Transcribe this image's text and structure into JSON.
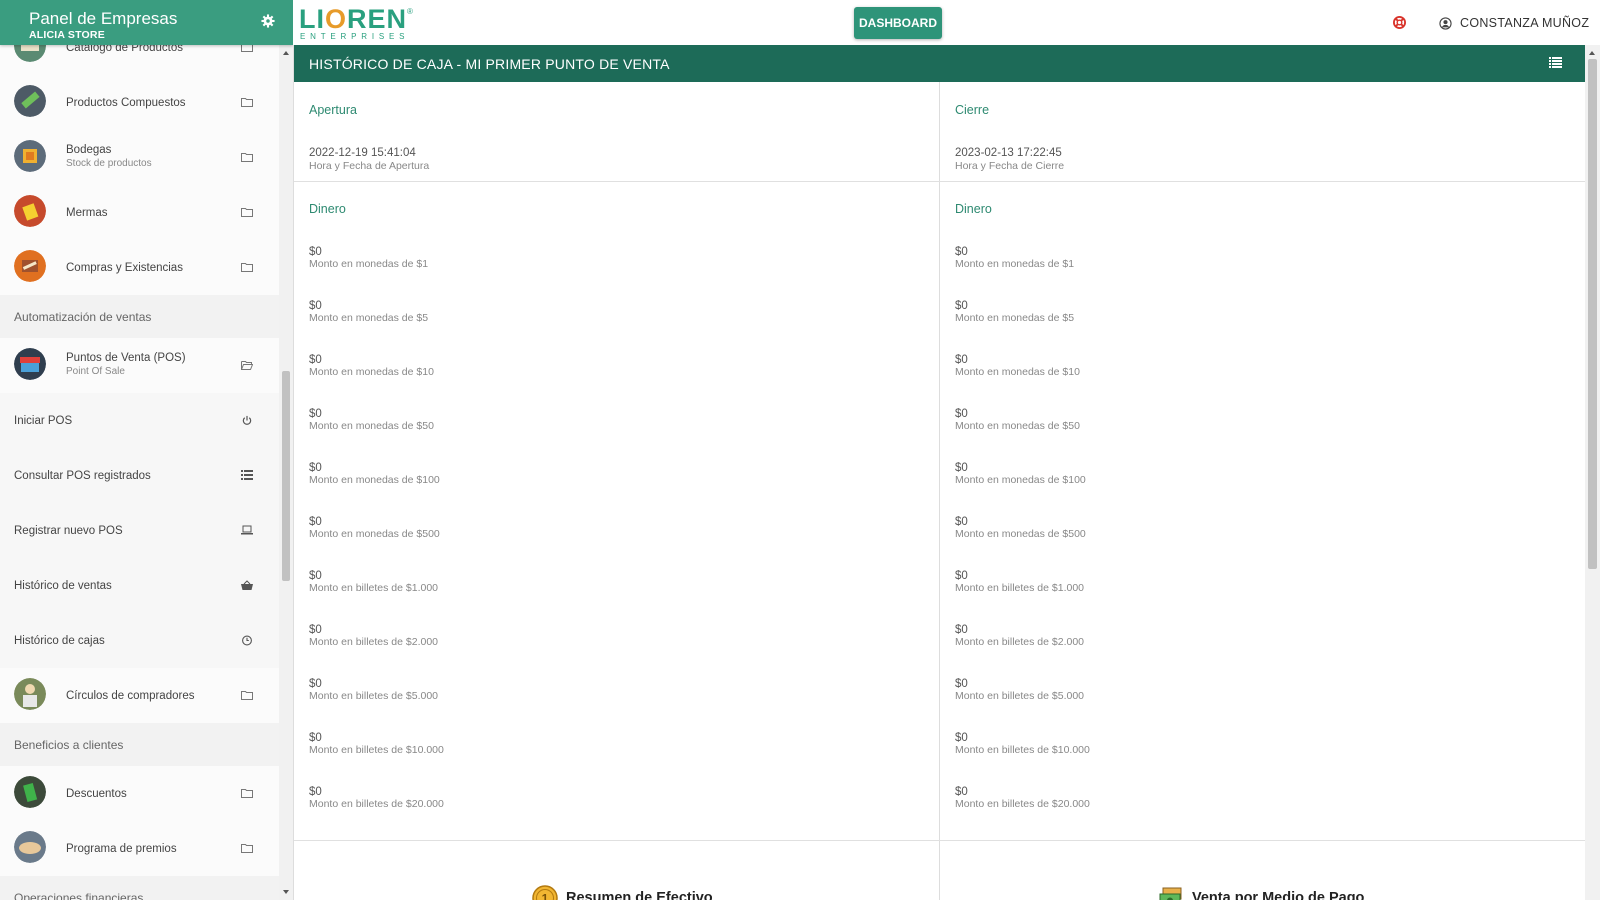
{
  "sidebar": {
    "title": "Panel de Empresas",
    "subtitle": "ALICIA STORE",
    "items": [
      {
        "label": "Catálogo de Productos"
      },
      {
        "label": "Productos Compuestos"
      },
      {
        "label": "Bodegas",
        "sub": "Stock de productos"
      },
      {
        "label": "Mermas"
      },
      {
        "label": "Compras y Existencias"
      }
    ],
    "section_automation": "Automatización de ventas",
    "pos": {
      "label": "Puntos de Venta (POS)",
      "sub": "Point Of Sale"
    },
    "pos_items": [
      {
        "label": "Iniciar POS"
      },
      {
        "label": "Consultar POS registrados"
      },
      {
        "label": "Registrar nuevo POS"
      },
      {
        "label": "Histórico de ventas"
      },
      {
        "label": "Histórico de cajas"
      }
    ],
    "circles": {
      "label": "Círculos de compradores"
    },
    "section_benefits": "Beneficios a clientes",
    "benefits": [
      {
        "label": "Descuentos"
      },
      {
        "label": "Programa de premios"
      }
    ],
    "section_financial": "Operaciones financieras"
  },
  "topbar": {
    "logo_word": "LIOREN",
    "logo_sub": "ENTERPRISES",
    "dashboard_label": "DASHBOARD",
    "user_name": "CONSTANZA MUÑOZ"
  },
  "main": {
    "title": "HISTÓRICO DE CAJA - MI PRIMER PUNTO DE VENTA",
    "opening": {
      "title": "Apertura",
      "datetime": "2022-12-19 15:41:04",
      "datetime_label": "Hora y Fecha de Apertura",
      "money_title": "Dinero"
    },
    "closing": {
      "title": "Cierre",
      "datetime": "2023-02-13 17:22:45",
      "datetime_label": "Hora y Fecha de Cierre",
      "money_title": "Dinero"
    },
    "amounts": [
      {
        "value": "$0",
        "label": "Monto en monedas de $1"
      },
      {
        "value": "$0",
        "label": "Monto en monedas de $5"
      },
      {
        "value": "$0",
        "label": "Monto en monedas de $10"
      },
      {
        "value": "$0",
        "label": "Monto en monedas de $50"
      },
      {
        "value": "$0",
        "label": "Monto en monedas de $100"
      },
      {
        "value": "$0",
        "label": "Monto en monedas de $500"
      },
      {
        "value": "$0",
        "label": "Monto en billetes de $1.000"
      },
      {
        "value": "$0",
        "label": "Monto en billetes de $2.000"
      },
      {
        "value": "$0",
        "label": "Monto en billetes de $5.000"
      },
      {
        "value": "$0",
        "label": "Monto en billetes de $10.000"
      },
      {
        "value": "$0",
        "label": "Monto en billetes de $20.000"
      }
    ],
    "cash_summary": "Resumen de Efectivo",
    "payment_summary": "Venta por Medio de Pago"
  },
  "colors": {
    "sidebar_header": "#3a9d80",
    "card_header": "#1d6b58",
    "accent_text": "#2e8a71",
    "button": "#2e9479"
  }
}
